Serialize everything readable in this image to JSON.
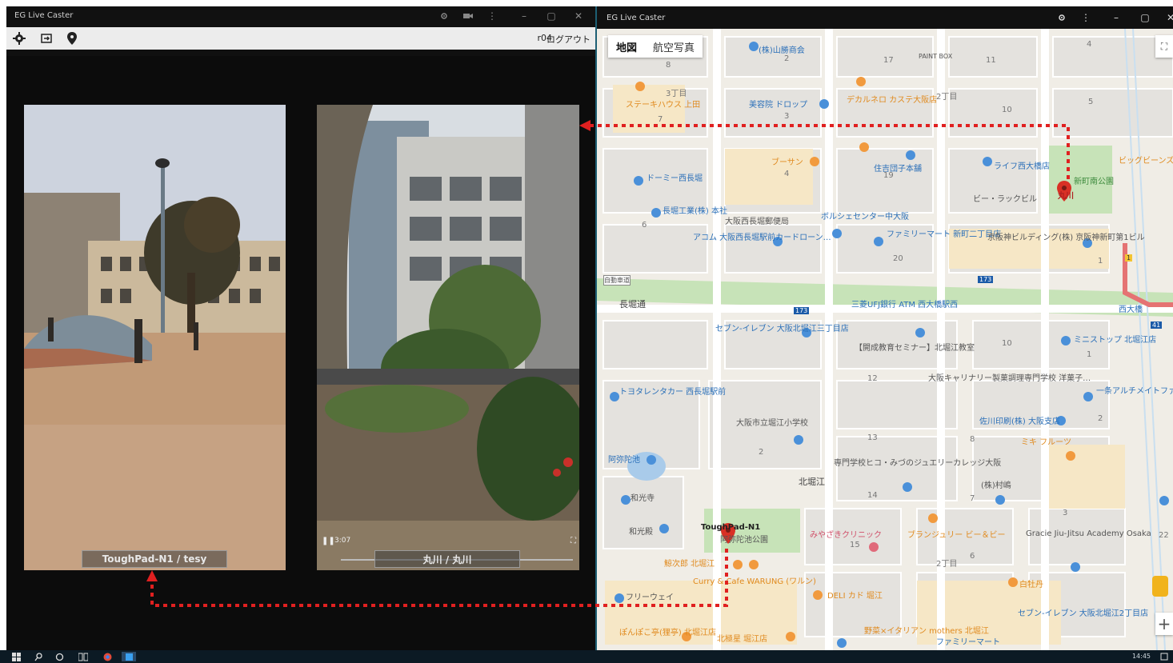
{
  "left_window": {
    "title": "EG Live Caster",
    "user": "r04",
    "logout_label": "ログアウト",
    "icons": [
      "gear-icon",
      "logout-box-icon",
      "location-pin-icon"
    ]
  },
  "videos": [
    {
      "label": "ToughPad-N1 / tesy"
    },
    {
      "label": "丸川 / 丸川",
      "time": "3:07"
    }
  ],
  "right_window": {
    "title": "EG Live Caster",
    "map_type": {
      "map": "地図",
      "satellite": "航空写真"
    },
    "zoom_in": "+"
  },
  "map_labels": {
    "pois": [
      "(株)山勝商会",
      "美容院 ドロップ",
      "デカルネロ カステ大阪店",
      "ステーキハウス 上田",
      "ドーミー西長堀",
      "ライフ西大橋店",
      "住吉団子本舗",
      "長堀工業(株) 本社",
      "大阪西長堀郵便局",
      "ボルシェセンター中大阪",
      "ファミリーマート 新町二丁目店",
      "アコム 大阪西長堀駅前カードローン…",
      "京阪神ビルディング(株) 京阪神新町第1ビル",
      "セブン-イレブン 大阪北堀江三丁目店",
      "三菱UFJ銀行 ATM 西大橋駅西",
      "【開成教育セミナー】北堀江教室",
      "ミニストップ 北堀江店",
      "トヨタレンタカー 西長堀駅前",
      "大阪キャリナリー製菓調理専門学校 洋菓子…",
      "一条アルチメイトファクトリー大阪",
      "佐川印刷(株) 大阪支店",
      "大阪市立堀江小学校",
      "阿弥陀池",
      "専門学校ヒコ・みづのジュエリーカレッジ大阪",
      "和光寺",
      "和光殿",
      "ToughPad-N1",
      "阿弥陀池公園",
      "みやざきクリニック",
      "ブランジュリー ビー＆ビー",
      "Gracie Jiu-Jitsu Academy Osaka",
      "(株)村嶋",
      "Curry & Cafe WARUNG (ワルン)",
      "DELI カド 堀江",
      "白牡丹",
      "セブン-イレブン 大阪北堀江2丁目店",
      "フリーウェイ",
      "ぽんぽこ亭(狸亭) 北堀江店",
      "北極星 堀江店",
      "野菜×イタリアン mothers 北堀江",
      "ファミリーマート",
      "ビッグビーンズ",
      "新町南公園",
      "丸川",
      "ビー・ラックビル",
      "PAINT BOX",
      "鯨次郎 北堀江",
      "ブーサン",
      "ミキ フルーツ"
    ],
    "streets": [
      "長堀通",
      "北堀江",
      "自動車道"
    ],
    "numbers": [
      "8",
      "2",
      "17",
      "11",
      "5",
      "3丁目",
      "7",
      "3",
      "2丁目",
      "10",
      "19",
      "4",
      "6",
      "20",
      "1",
      "8",
      "10",
      "12",
      "13",
      "8",
      "2",
      "2",
      "14",
      "7",
      "3",
      "15",
      "6",
      "2丁目",
      "22",
      "1",
      "4"
    ],
    "route_badges": [
      "173",
      "173",
      "41",
      "1"
    ],
    "station": "西大橋"
  },
  "taskbar": {
    "time": "14:45",
    "icons": [
      "windows-start-icon",
      "search-icon",
      "cortana-icon",
      "task-view-icon",
      "chrome-icon",
      "app-icon"
    ]
  }
}
